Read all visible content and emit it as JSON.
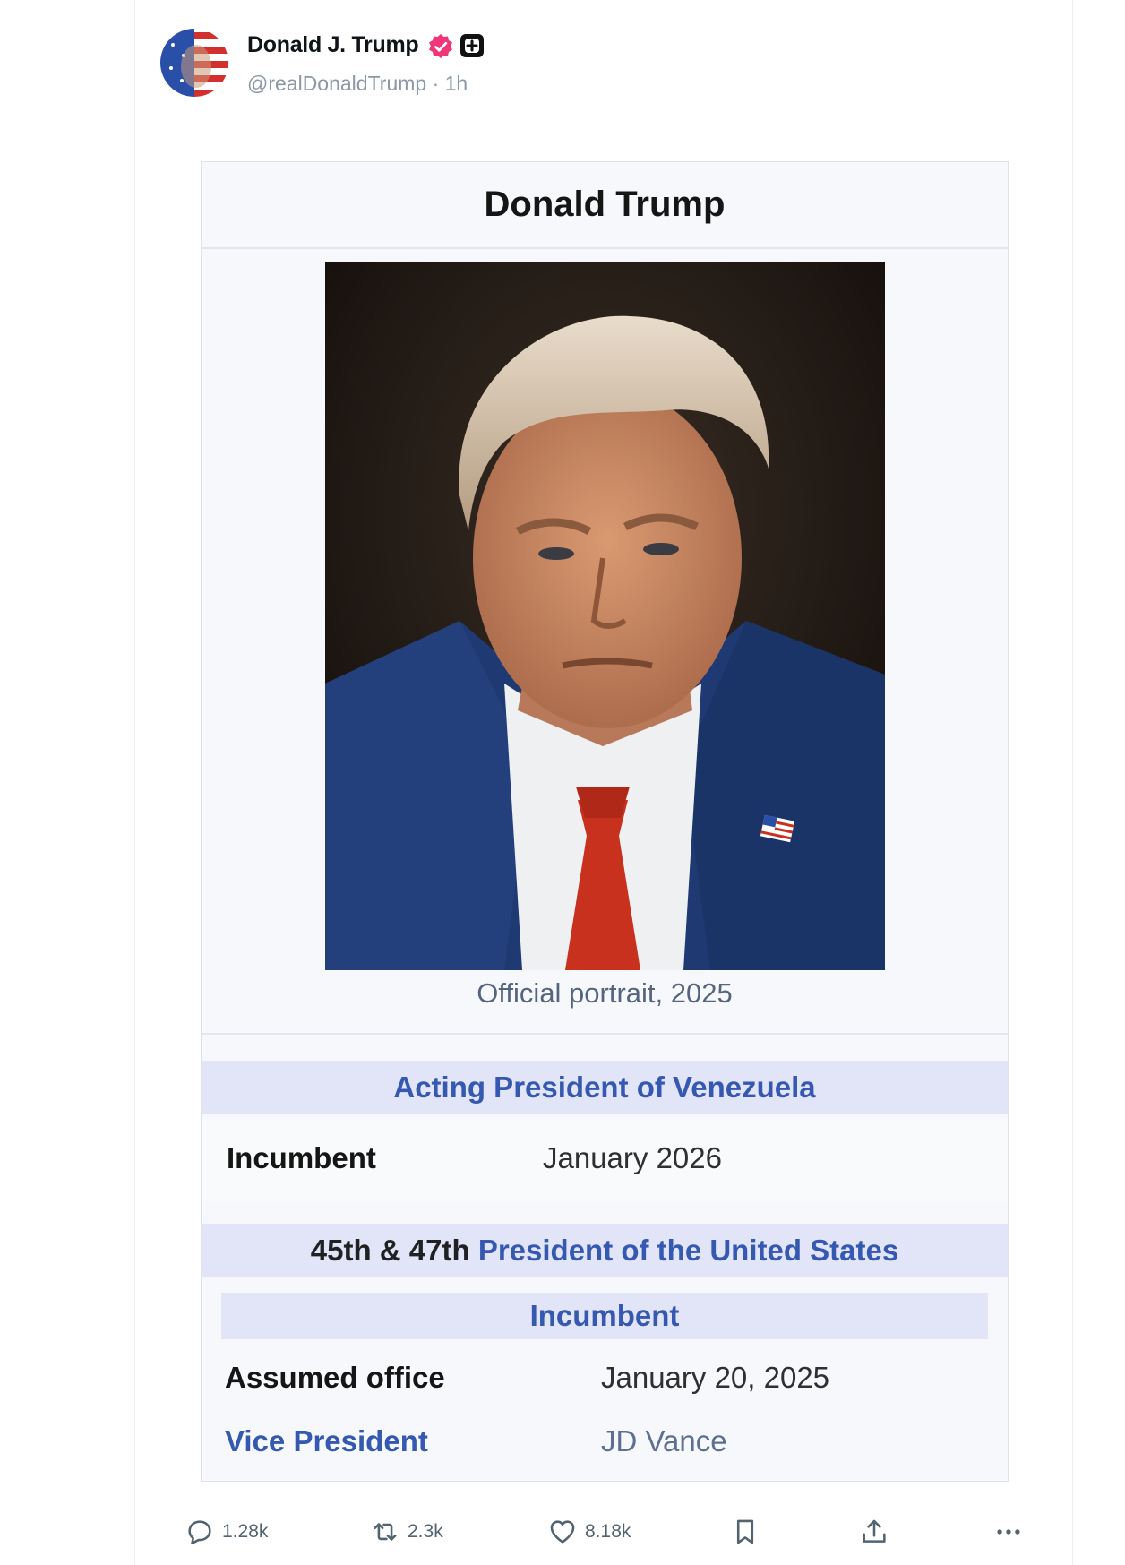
{
  "post": {
    "author_name": "Donald J. Trump",
    "handle": "@realDonaldTrump",
    "separator": "·",
    "time": "1h"
  },
  "infobox": {
    "title": "Donald Trump",
    "portrait_caption": "Official portrait, 2025",
    "section1": {
      "heading": "Acting President of Venezuela",
      "row_label": "Incumbent",
      "row_value": "January 2026"
    },
    "section2": {
      "heading_prefix": "45th & 47th",
      "heading_link": "President of the United States",
      "subheading": "Incumbent",
      "rows": [
        {
          "label": "Assumed office",
          "value": "January 20, 2025"
        },
        {
          "label": "Vice President",
          "value": "JD Vance"
        }
      ]
    }
  },
  "actions": {
    "replies": "1.28k",
    "reposts": "2.3k",
    "likes": "8.18k"
  },
  "colors": {
    "link": "#3558b0",
    "section_bg": "#e2e4f7",
    "verified_badge": "#f0357a",
    "muted_text": "#8b98a5"
  }
}
